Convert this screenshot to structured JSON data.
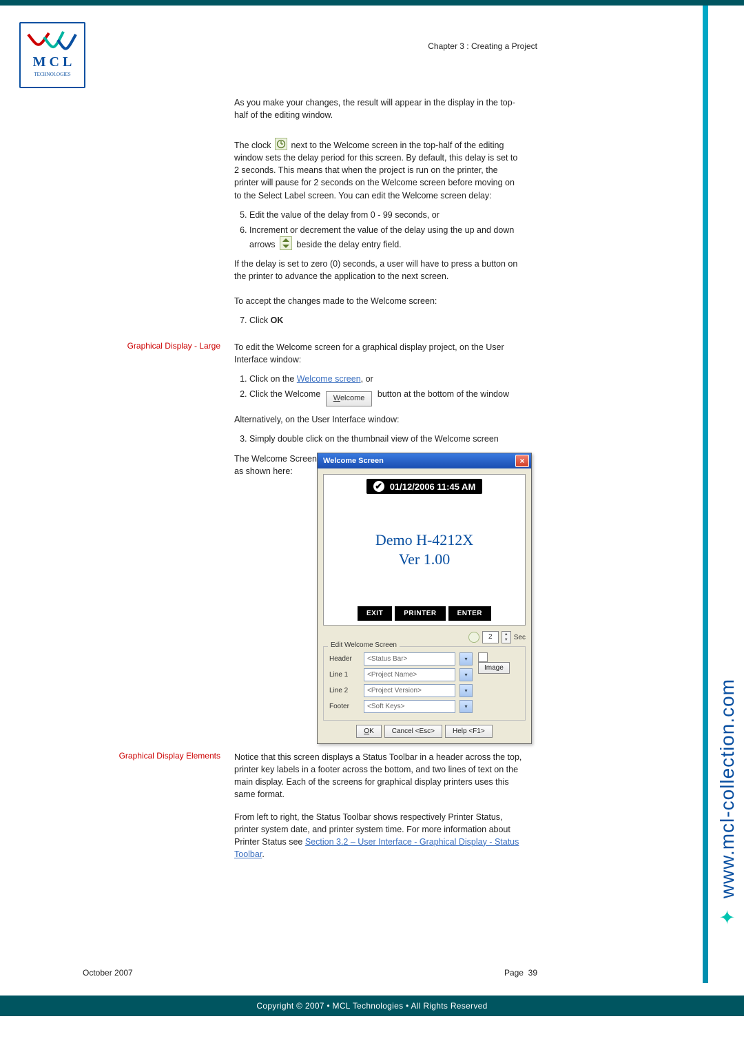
{
  "chapter": "Chapter 3 : Creating a Project",
  "side_url": "www.mcl-collection.com",
  "logo": {
    "top": "M C L",
    "bottom": "TECHNOLOGIES"
  },
  "body": {
    "p1": "As you make your changes, the result will appear in the display in the top-half of the editing window.",
    "p2a": "The clock ",
    "p2b": " next to the Welcome screen in the top-half of the editing window sets the delay period for this screen. By default, this delay is set to 2 seconds. This means that when the project is run on the printer, the printer will pause for 2 seconds on the Welcome screen before moving on to the Select Label screen. You can edit the Welcome screen delay:",
    "li5": "Edit the value of the delay from 0 - 99 seconds, or",
    "li6a": "Increment or decrement the value of the delay using the up and down arrows ",
    "li6b": " beside the delay entry field.",
    "p3": "If the delay is set to zero (0) seconds, a user will have to press a button on the printer to advance the application to the next screen.",
    "p4": "To accept the changes made to the Welcome screen:",
    "li7": "Click ",
    "li7_ok": "OK",
    "sideA": "Graphical Display - Large",
    "p5": "To edit the Welcome screen for a graphical display project, on the User Interface window:",
    "li1a": "Click on the ",
    "li1_link": "Welcome screen",
    "li1b": ", or",
    "li2a": "Click the Welcome ",
    "li2_btn": "Welcome",
    "li2b": " button at the bottom of the window",
    "p6": "Alternatively, on the User Interface window:",
    "li3": "Simply double click on the thumbnail view of the Welcome screen",
    "p7": "The Welcome Screen editing window for a large graphical display printer is as shown here:",
    "sideB": "Graphical Display Elements",
    "p8": "Notice that this screen displays a Status Toolbar in a header across the top, printer key labels in a footer across the bottom, and two lines of text on the main display. Each of the screens for graphical display printers uses this same format.",
    "p9a": "From left to right, the Status Toolbar shows respectively Printer Status, printer system date, and printer system time. For more information about Printer Status see ",
    "p9_link": "Section 3.2 – User Interface - Graphical Display - Status Toolbar",
    "p9b": "."
  },
  "dialog": {
    "title": "Welcome Screen",
    "close": "×",
    "status_datetime": "01/12/2006 11:45 AM",
    "preview_line1": "Demo H-4212X",
    "preview_line2": "Ver 1.00",
    "soft_keys": [
      "EXIT",
      "PRINTER",
      "ENTER"
    ],
    "delay_value": "2",
    "delay_unit": "Sec",
    "group_legend": "Edit Welcome Screen",
    "image_label": "Image",
    "rows": [
      {
        "label": "Header",
        "value": "<Status Bar>"
      },
      {
        "label": "Line 1",
        "value": "<Project Name>"
      },
      {
        "label": "Line 2",
        "value": "<Project Version>"
      },
      {
        "label": "Footer",
        "value": "<Soft Keys>"
      }
    ],
    "buttons": {
      "ok": "OK",
      "cancel": "Cancel <Esc>",
      "help": "Help <F1>"
    }
  },
  "footer": {
    "left": "October 2007",
    "right_label": "Page",
    "page": "39"
  },
  "copyright": "Copyright © 2007 • MCL Technologies • All Rights Reserved"
}
